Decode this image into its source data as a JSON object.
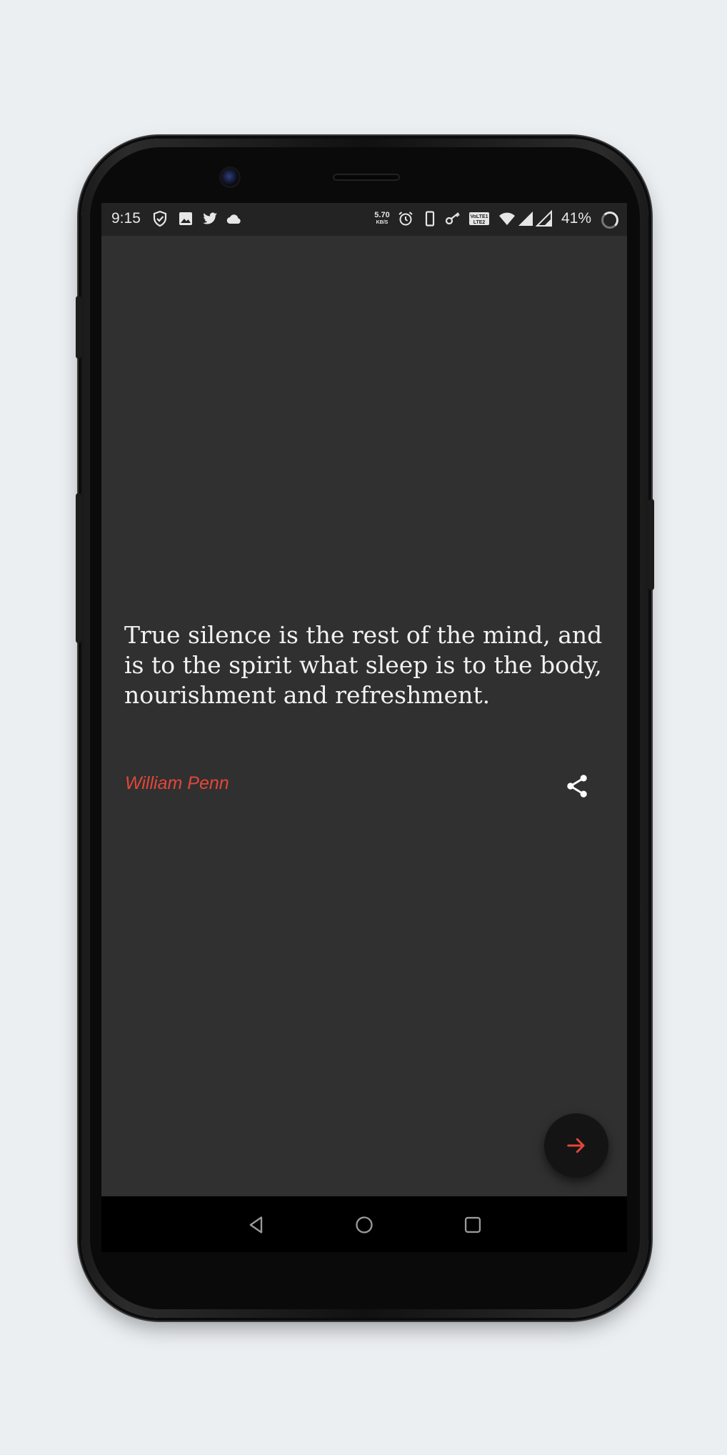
{
  "status_bar": {
    "time": "9:15",
    "network_speed_value": "5.70",
    "network_speed_unit": "KB/S",
    "battery_percent": "41%",
    "icons": [
      "shield-check-icon",
      "image-icon",
      "twitter-icon",
      "cloud-icon",
      "alarm-icon",
      "phone-icon",
      "key-icon",
      "volte-icon",
      "wifi-icon",
      "signal-icon",
      "signal-icon",
      "battery-ring-icon"
    ]
  },
  "quote": {
    "text": "True silence is the rest of the mind, and is to the spirit what sleep is to the body, nourishment and refreshment.",
    "author": "William Penn"
  },
  "actions": {
    "share_icon": "share-icon",
    "next_icon": "arrow-right-icon"
  },
  "nav_bar": {
    "icons": [
      "back-icon",
      "home-icon",
      "recents-icon"
    ]
  },
  "colors": {
    "background": "#ebeff2",
    "screen": "#303030",
    "status_bar": "#232323",
    "accent": "#e2473a",
    "quote_text": "#f1f1f1",
    "fab": "#141414"
  }
}
